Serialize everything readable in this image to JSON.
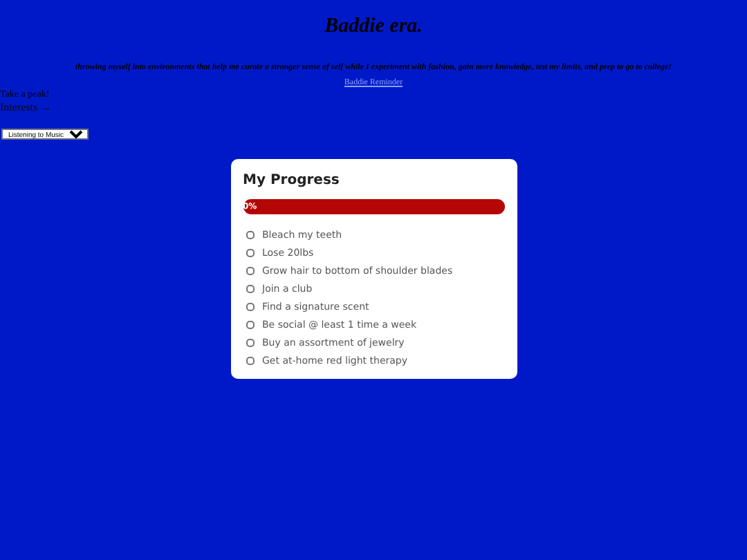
{
  "title": "Baddie era.",
  "tagline": "throwing myself into environments that help me curate a stronger sense of self while I experiment with fashion, gain more knowledge, test my limits, and prep to go to college!",
  "link": "Baddie Reminder",
  "peek": "Take a peak!",
  "interests": "Interests →",
  "select": {
    "value": "Listening to Music"
  },
  "progress": {
    "title": "My Progress",
    "level": 0,
    "reading": "0%",
    "items": [
      {
        "label": "Bleach my teeth",
        "checked": false
      },
      {
        "label": "Lose 20lbs",
        "checked": false
      },
      {
        "label": "Grow hair to bottom of shoulder blades",
        "checked": false
      },
      {
        "label": "Join a club",
        "checked": false
      },
      {
        "label": "Find a signature scent",
        "checked": false
      },
      {
        "label": "Be social @ least 1 time a week",
        "checked": false
      },
      {
        "label": "Buy an assortment of jewelry",
        "checked": false
      },
      {
        "label": "Get at-home red light therapy",
        "checked": false
      }
    ]
  }
}
